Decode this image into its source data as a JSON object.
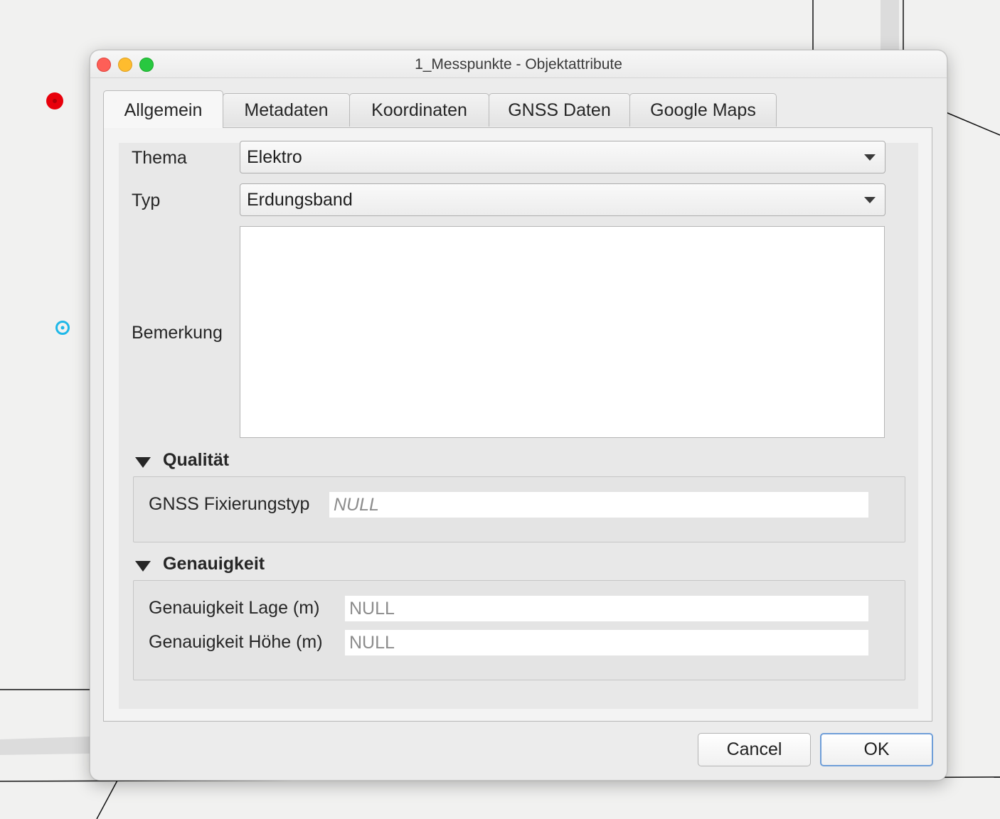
{
  "window": {
    "title": "1_Messpunkte - Objektattribute"
  },
  "tabs": [
    {
      "label": "Allgemein",
      "active": true
    },
    {
      "label": "Metadaten",
      "active": false
    },
    {
      "label": "Koordinaten",
      "active": false
    },
    {
      "label": "GNSS Daten",
      "active": false
    },
    {
      "label": "Google Maps",
      "active": false
    }
  ],
  "form": {
    "thema": {
      "label": "Thema",
      "value": "Elektro"
    },
    "typ": {
      "label": "Typ",
      "value": "Erdungsband"
    },
    "bemerkung": {
      "label": "Bemerkung",
      "value": ""
    }
  },
  "groups": {
    "qualitaet": {
      "title": "Qualität",
      "gnss_fix": {
        "label": "GNSS Fixierungstyp",
        "value": "NULL"
      }
    },
    "genauigkeit": {
      "title": "Genauigkeit",
      "lage": {
        "label": "Genauigkeit Lage (m)",
        "value": "NULL"
      },
      "hoehe": {
        "label": "Genauigkeit Höhe (m)",
        "value": "NULL"
      }
    }
  },
  "buttons": {
    "cancel": "Cancel",
    "ok": "OK"
  },
  "colors": {
    "map_point_red": "#e8000b",
    "map_point_cyan": "#1fb8e8",
    "default_button_border": "#6f9ed8"
  }
}
